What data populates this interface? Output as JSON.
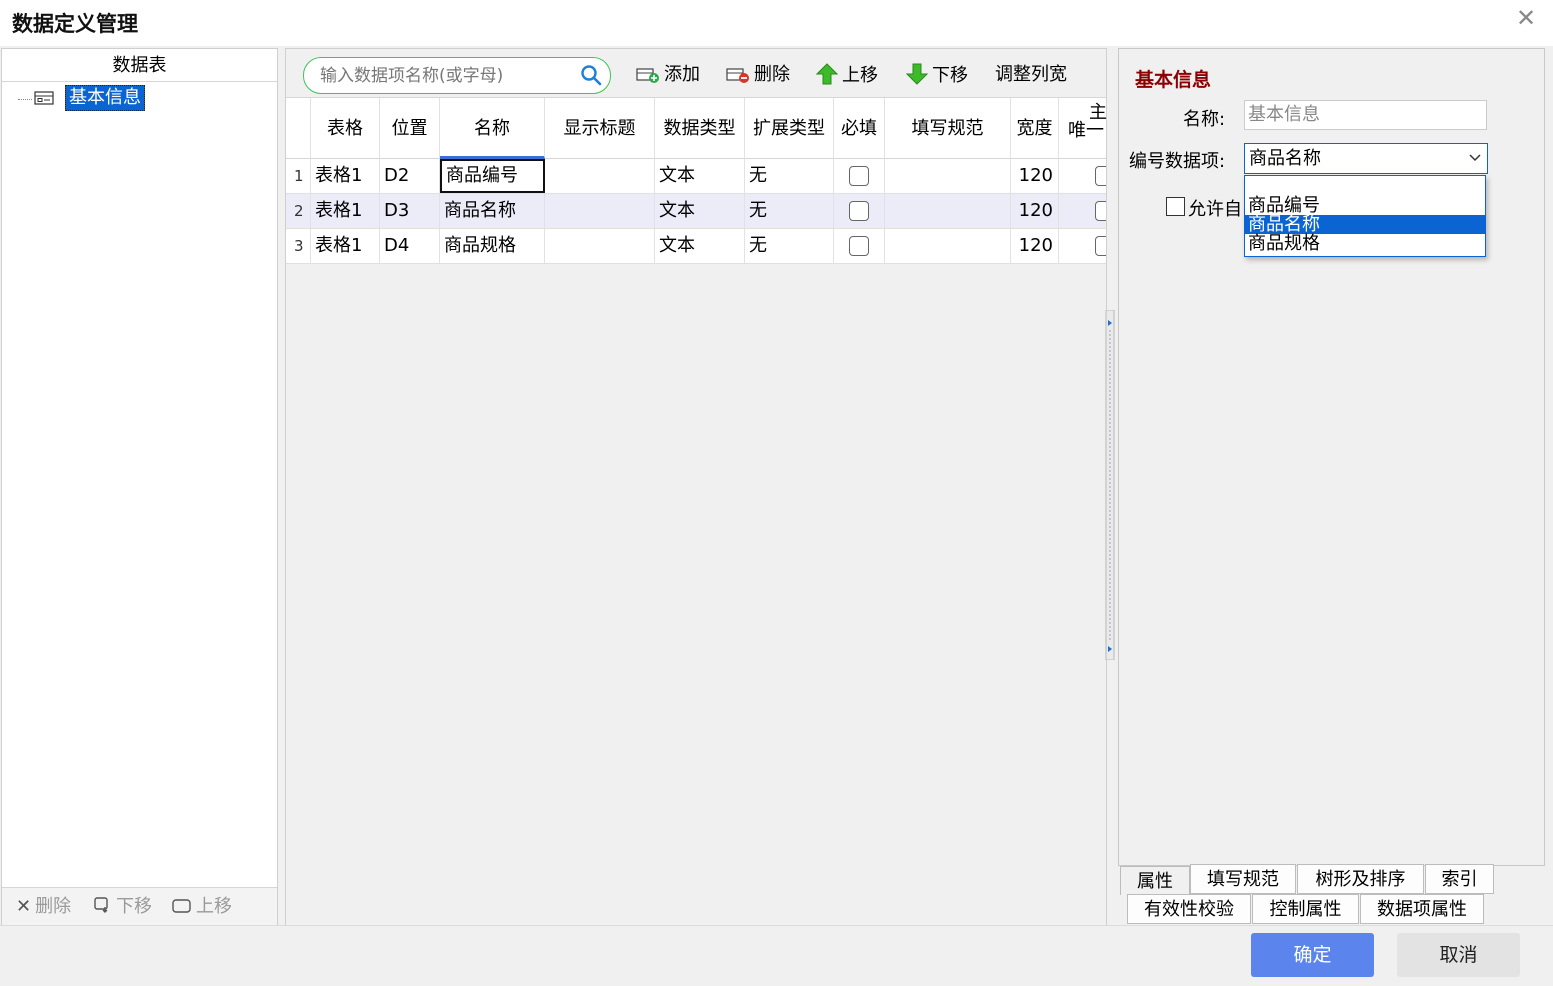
{
  "window": {
    "title": "数据定义管理",
    "close": "✕"
  },
  "left_panel": {
    "header": "数据表",
    "tree": [
      {
        "label": "基本信息",
        "selected": true
      }
    ],
    "footer": {
      "delete": "删除",
      "move_down": "下移",
      "move_up": "上移"
    }
  },
  "toolbar": {
    "search_placeholder": "输入数据项名称(或字母)",
    "add": "添加",
    "delete": "删除",
    "move_up": "上移",
    "move_down": "下移",
    "adjust_width": "调整列宽"
  },
  "grid": {
    "columns": [
      "表格",
      "位置",
      "名称",
      "显示标题",
      "数据类型",
      "扩展类型",
      "必填",
      "填写规范",
      "宽度",
      "主",
      "唯一"
    ],
    "rows": [
      {
        "num": "1",
        "table": "表格1",
        "pos": "D2",
        "name": "商品编号",
        "title": "",
        "dtype": "文本",
        "ext": "无",
        "width": "120"
      },
      {
        "num": "2",
        "table": "表格1",
        "pos": "D3",
        "name": "商品名称",
        "title": "",
        "dtype": "文本",
        "ext": "无",
        "width": "120"
      },
      {
        "num": "3",
        "table": "表格1",
        "pos": "D4",
        "name": "商品规格",
        "title": "",
        "dtype": "文本",
        "ext": "无",
        "width": "120"
      }
    ]
  },
  "right_panel": {
    "title": "基本信息",
    "name_label": "名称:",
    "name_value": "基本信息",
    "code_label": "编号数据项:",
    "code_value": "商品名称",
    "options": [
      "商品编号",
      "商品名称",
      "商品规格"
    ],
    "selected_option_index": 1,
    "allow_label": "允许自",
    "tabs_row1": [
      "属性",
      "填写规范",
      "树形及排序",
      "索引"
    ],
    "tabs_row2": [
      "有效性校验",
      "控制属性",
      "数据项属性"
    ]
  },
  "footer": {
    "ok": "确定",
    "cancel": "取消"
  },
  "colors": {
    "accent": "#0a64d2",
    "ok_button": "#5b85ec",
    "info_title": "#8b0000",
    "search_border": "#3fc35a"
  }
}
